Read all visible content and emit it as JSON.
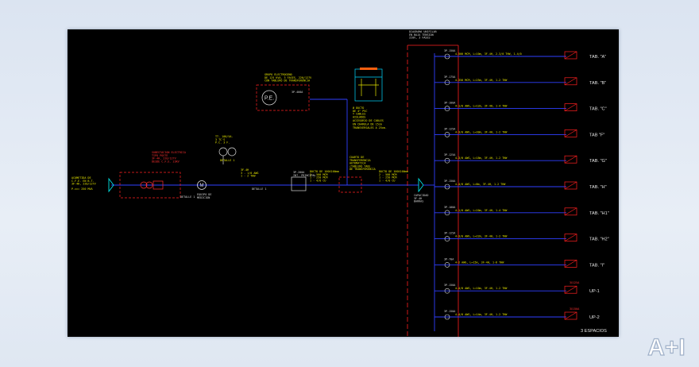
{
  "diagram": {
    "title_block": [
      "DIAGRAMA UNIFILAR",
      "EN BAJA TENSION",
      "220V, 3 FASES"
    ],
    "incoming": {
      "label_lines": [
        "ACOMETIDA DE",
        "C.F.E. EN B.T.",
        "3F-4H, 220/127V"
      ],
      "power": "P.cc= 250 MVA"
    },
    "substation": {
      "label_lines": [
        "SUBESTACION ELECTRICA",
        "TIPO POSTE",
        "3F-4H, 220/127V",
        "DESDE C.F.E. 23KV"
      ],
      "detail": "DETALLE 1"
    },
    "meter": {
      "symbol": "M",
      "label_lines": [
        "EQUIPO DE",
        "MEDICION"
      ]
    },
    "ct": {
      "label_lines": [
        "TT. 100/5A.",
        "3 TC'S",
        "P.C. 3 F."
      ],
      "detail": "DETALLE 1"
    },
    "feeder_1": {
      "label_lines": [
        "3F-4H",
        "3 - 1/0 AWG",
        "1 - 2 THW"
      ],
      "detail": "DETALLE 1"
    },
    "main_breaker": {
      "label_lines": [
        "3P-200A",
        "INT. PRINCIPAL"
      ]
    },
    "busway_1": {
      "label_lines": [
        "DUCTO DE 100X100mm",
        "2 - 500 MCM",
        "1 - 250 MCM",
        "1 - 4/0 CU"
      ]
    },
    "transfer": {
      "label_lines": [
        "CUARTO DE",
        "TRANSFERENCIA",
        "AUTOMATICA",
        "(TABLERO TAB)",
        "DE TRANSFERENCIA"
      ]
    },
    "busway_2": {
      "label_lines": [
        "DUCTO DE 100X100mm",
        "2 - 500 MCM",
        "1 - 250 MCM",
        "1 - 4/0 CU"
      ]
    },
    "generator": {
      "symbol": "P.E.",
      "label_lines": [
        "GRUPO ELECTROGENO",
        "DE 125 KVA, 3 FASES, 220/127V",
        "CON TABLERO DE TRANSFERENCIA"
      ],
      "breaker": "3P-400A"
    },
    "trench": {
      "note_lines": [
        "ACCESORIO DE CABLES",
        "EN CHAROLA DE 15cm",
        "TRANSVERSALES A 25cm."
      ],
      "small_lines": [
        "Ø DUCTO",
        "DE 4\" PVC",
        "Y CABLES",
        "AISLADOS"
      ]
    },
    "main_bus": {
      "label_lines": [
        "CAPACIDAD",
        "3F-4H",
        "BARRAS"
      ]
    },
    "branches": [
      {
        "breaker": "3P-150A",
        "cable": "4-500 MCM, L=10m, 3F-4H, 2-3/0 THW, 1-4/0",
        "tag": "TAB. \"A\""
      },
      {
        "breaker": "3P-175A",
        "cable": "4-350 MCM, L=25m, 3F-4H, 1-2 THW",
        "tag": "TAB. \"B\""
      },
      {
        "breaker": "3P-100A",
        "cable": "4-1/0 AWG, L=12m, 3F-4H, 1-4 THW",
        "tag": "TAB. \"C\""
      },
      {
        "breaker": "3P-125A",
        "cable": "4-3/0 AWG, L=30m, 3F-4H, 1-2 THW",
        "tag": "TAB \"F\""
      },
      {
        "breaker": "3P-125A",
        "cable": "4-3/0 AWG, L=18m, 3F-4H, 1-2 THW",
        "tag": "TAB. \"G\""
      },
      {
        "breaker": "3P-150A",
        "cable": "4-4/0 AWG, L=8m, 3F-4H, 1-2 THW",
        "tag": "TAB. \"H\""
      },
      {
        "breaker": "3P-100A",
        "cable": "4-1/0 AWG, L=20m, 3F-4H, 1-4 THW",
        "tag": "TAB. \"H1\""
      },
      {
        "breaker": "3P-125A",
        "cable": "4-3/0 AWG, L=22m, 3F-4H, 1-2 THW",
        "tag": "TAB. \"H2\""
      },
      {
        "breaker": "3P-70A",
        "cable": "4-2 AWG, L=15m, 3F-4H, 1-6 THW",
        "tag": "TAB. \"I\""
      },
      {
        "breaker": "3P-150A",
        "cable": "4-4/0 AWG, L=10m, 3F-4H, 1-2 THW",
        "tag": "UP-1",
        "box": "3X125A"
      },
      {
        "breaker": "3P-150A",
        "cable": "4-4/0 AWG, L=14m, 3F-4H, 1-2 THW",
        "tag": "UP-2",
        "box": "3X150A"
      }
    ],
    "spares": "3 ESPACIOS"
  },
  "watermark": {
    "text": "A+I"
  }
}
